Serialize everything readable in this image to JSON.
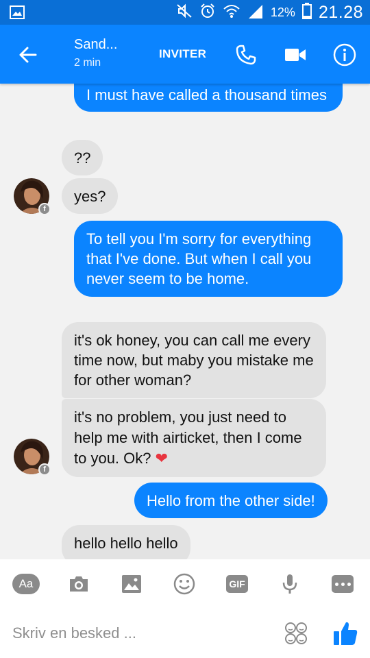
{
  "status_bar": {
    "battery_percent": "12%",
    "time": "21.28",
    "icons": [
      "gallery-icon",
      "mute-icon",
      "alarm-icon",
      "wifi-icon",
      "signal-icon",
      "battery-icon"
    ]
  },
  "header": {
    "contact_name": "Sand...",
    "last_active": "2 min",
    "invite_label": "INVITER",
    "icons": [
      "back-arrow-icon",
      "phone-icon",
      "video-camera-icon",
      "info-icon"
    ]
  },
  "messages": [
    {
      "side": "out",
      "text": "I must have called a thousand times"
    },
    {
      "side": "in",
      "text": "??"
    },
    {
      "side": "in",
      "text": "yes?"
    },
    {
      "side": "out",
      "text": "To tell you I'm sorry for everything that I've done. But when I call you never seem to be home."
    },
    {
      "side": "in",
      "text": "it's ok honey, you can call me every time now, but maby you mistake me for other woman?"
    },
    {
      "side": "in",
      "text": "it's no problem, you just need to help me with airticket, then I come to you. Ok?",
      "emoji": "❤"
    },
    {
      "side": "out",
      "text": "Hello from the other side!"
    },
    {
      "side": "in",
      "text": "hello hello hello"
    }
  ],
  "composer": {
    "toolbar": {
      "aa_label": "Aa",
      "gif_label": "GIF",
      "icons": [
        "text-style-icon",
        "camera-icon",
        "image-icon",
        "emoji-icon",
        "gif-icon",
        "microphone-icon",
        "more-icon"
      ]
    },
    "input_placeholder": "Skriv en besked ...",
    "icons": [
      "stickers-icon",
      "like-thumb-icon"
    ]
  },
  "colors": {
    "status_bar": "#0a6fd6",
    "header": "#0b84ff",
    "outgoing_bubble": "#0b84ff",
    "incoming_bubble": "#e2e2e2",
    "chat_background": "#f2f2f2",
    "heart": "#e8353f"
  }
}
